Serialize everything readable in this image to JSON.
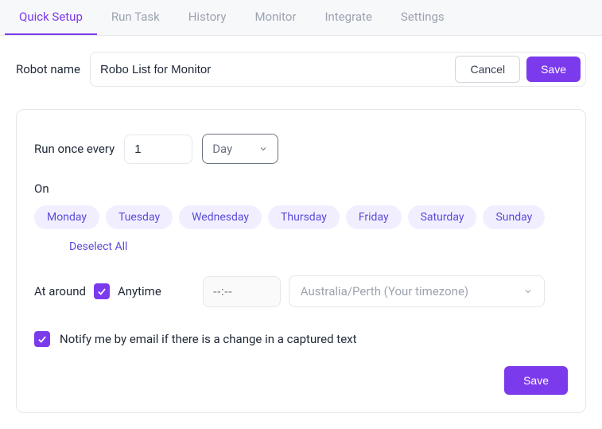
{
  "tabs": [
    {
      "label": "Quick Setup",
      "active": true
    },
    {
      "label": "Run Task",
      "active": false
    },
    {
      "label": "History",
      "active": false
    },
    {
      "label": "Monitor",
      "active": false
    },
    {
      "label": "Integrate",
      "active": false
    },
    {
      "label": "Settings",
      "active": false
    }
  ],
  "robot": {
    "label": "Robot name",
    "value": "Robo List for Monitor",
    "cancel": "Cancel",
    "save": "Save"
  },
  "schedule": {
    "run_label": "Run once every",
    "freq_value": "1",
    "freq_unit": "Day",
    "on_label": "On",
    "days": [
      "Monday",
      "Tuesday",
      "Wednesday",
      "Thursday",
      "Friday",
      "Saturday",
      "Sunday"
    ],
    "deselect": "Deselect All",
    "around_label": "At around",
    "anytime_checked": true,
    "anytime_label": "Anytime",
    "time_placeholder": "--:--",
    "timezone": "Australia/Perth (Your timezone)",
    "notify_checked": true,
    "notify_label": "Notify me by email if there is a change in a captured text",
    "save": "Save"
  }
}
